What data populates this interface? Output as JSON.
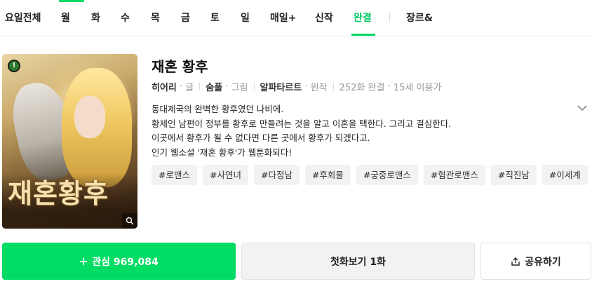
{
  "nav": {
    "tabs": [
      {
        "label": "요일전체",
        "active": false
      },
      {
        "label": "월",
        "active": false
      },
      {
        "label": "화",
        "active": false
      },
      {
        "label": "수",
        "active": false
      },
      {
        "label": "목",
        "active": false
      },
      {
        "label": "금",
        "active": false
      },
      {
        "label": "토",
        "active": false
      },
      {
        "label": "일",
        "active": false
      },
      {
        "label": "매일+",
        "active": false
      },
      {
        "label": "신작",
        "active": false
      },
      {
        "label": "완결",
        "active": true
      },
      {
        "label": "장르&",
        "active": false
      }
    ]
  },
  "cover": {
    "age_badge": "!",
    "title_art": "재혼황후",
    "zoom_icon": "search-icon"
  },
  "work": {
    "title": "재혼 황후",
    "writer": "히어리",
    "writer_role": "글",
    "artist": "숨풀",
    "artist_role": "그림",
    "original": "알파타르트",
    "original_role": "원작",
    "status": "252화 완결",
    "age": "15세 이용가",
    "description": [
      "동대제국의 완벽한 황후였던 나비에.",
      "황제인 남편이 정부를 황후로 만들려는 것을 알고 이혼을 택한다. 그리고 결심한다.",
      "이곳에서 황후가 될 수 없다면 다른 곳에서 황후가 되겠다고.",
      "인기 웹소설 '재혼 황후'가 웹툰화되다!"
    ],
    "tags": [
      "#로맨스",
      "#사연녀",
      "#다정남",
      "#후회물",
      "#궁중로맨스",
      "#혐관로맨스",
      "#직진남",
      "#이세계"
    ]
  },
  "actions": {
    "favorite_label": "관심 969,084",
    "first_episode_label": "첫화보기 1화",
    "share_label": "공유하기"
  },
  "colors": {
    "accent": "#00dc64",
    "button_gray": "#f2f2f2"
  }
}
